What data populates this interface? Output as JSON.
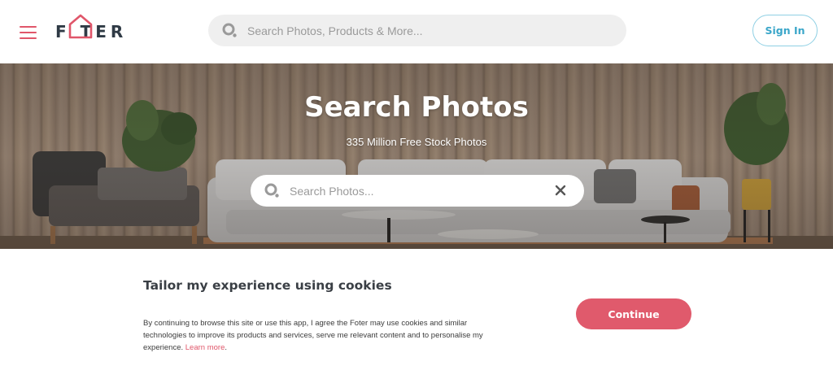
{
  "header": {
    "logo_text": "F   TER",
    "search_placeholder": "Search Photos, Products & More...",
    "signin_label": "Sign In"
  },
  "hero": {
    "title": "Search Photos",
    "subtitle": "335 Million Free Stock Photos",
    "search_placeholder": "Search Photos..."
  },
  "cookie": {
    "title": "Tailor my experience using cookies",
    "body": "By continuing to browse this site or use this app, I agree the Foter may use cookies and similar technologies to improve its products and services, serve me relevant content and to personalise my experience.",
    "learn_more": "Learn more",
    "continue_label": "Continue"
  },
  "colors": {
    "brand_pink": "#e0566a",
    "signin_blue": "#3aa6c9",
    "search_bg": "#efefef"
  },
  "icons": [
    "hamburger-menu-icon",
    "logo-house-icon",
    "search-icon",
    "close-icon"
  ]
}
